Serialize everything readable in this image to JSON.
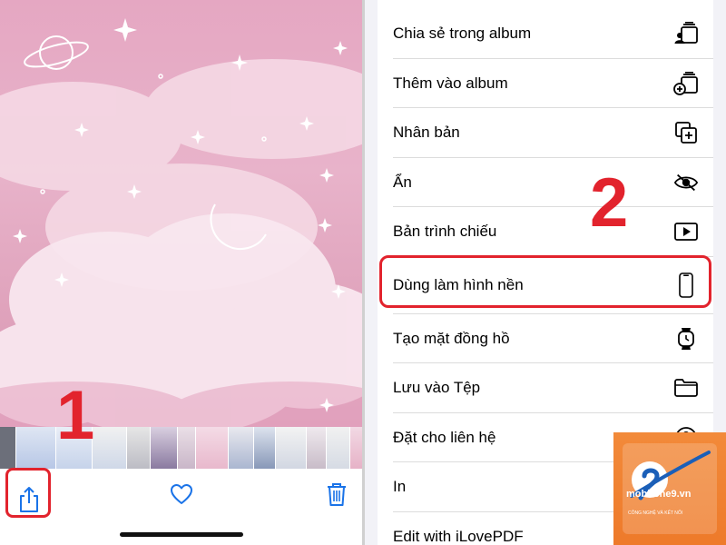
{
  "steps": {
    "step1": "1",
    "step2": "2"
  },
  "toolbar": {
    "share_icon": "share-icon",
    "favorite_icon": "heart-icon",
    "delete_icon": "trash-icon"
  },
  "menu": {
    "items": [
      {
        "label": "Chia sẻ trong album",
        "icon": "shared-album-icon"
      },
      {
        "label": "Thêm vào album",
        "icon": "add-to-album-icon"
      },
      {
        "label": "Nhân bản",
        "icon": "duplicate-icon"
      },
      {
        "label": "Ẩn",
        "icon": "hide-eye-icon"
      },
      {
        "label": "Bản trình chiếu",
        "icon": "slideshow-play-icon"
      },
      {
        "label": "Dùng làm hình nền",
        "icon": "phone-wallpaper-icon"
      },
      {
        "label": "Tạo mặt đồng hồ",
        "icon": "watch-face-icon"
      },
      {
        "label": "Lưu vào Tệp",
        "icon": "folder-icon"
      },
      {
        "label": "Đặt cho liên hệ",
        "icon": "contact-icon"
      },
      {
        "label": "In",
        "icon": "print-icon"
      },
      {
        "label": "Edit with iLovePDF",
        "icon": "ilovepdf-icon"
      }
    ]
  },
  "logo": {
    "name": "mobifone9",
    "domain": ".vn",
    "tagline": "CÔNG NGHỆ VÀ KẾT NỐI"
  },
  "colors": {
    "accent_red": "#e2232d",
    "ios_blue": "#1a73e8",
    "logo_orange": "#ee7a2a"
  }
}
